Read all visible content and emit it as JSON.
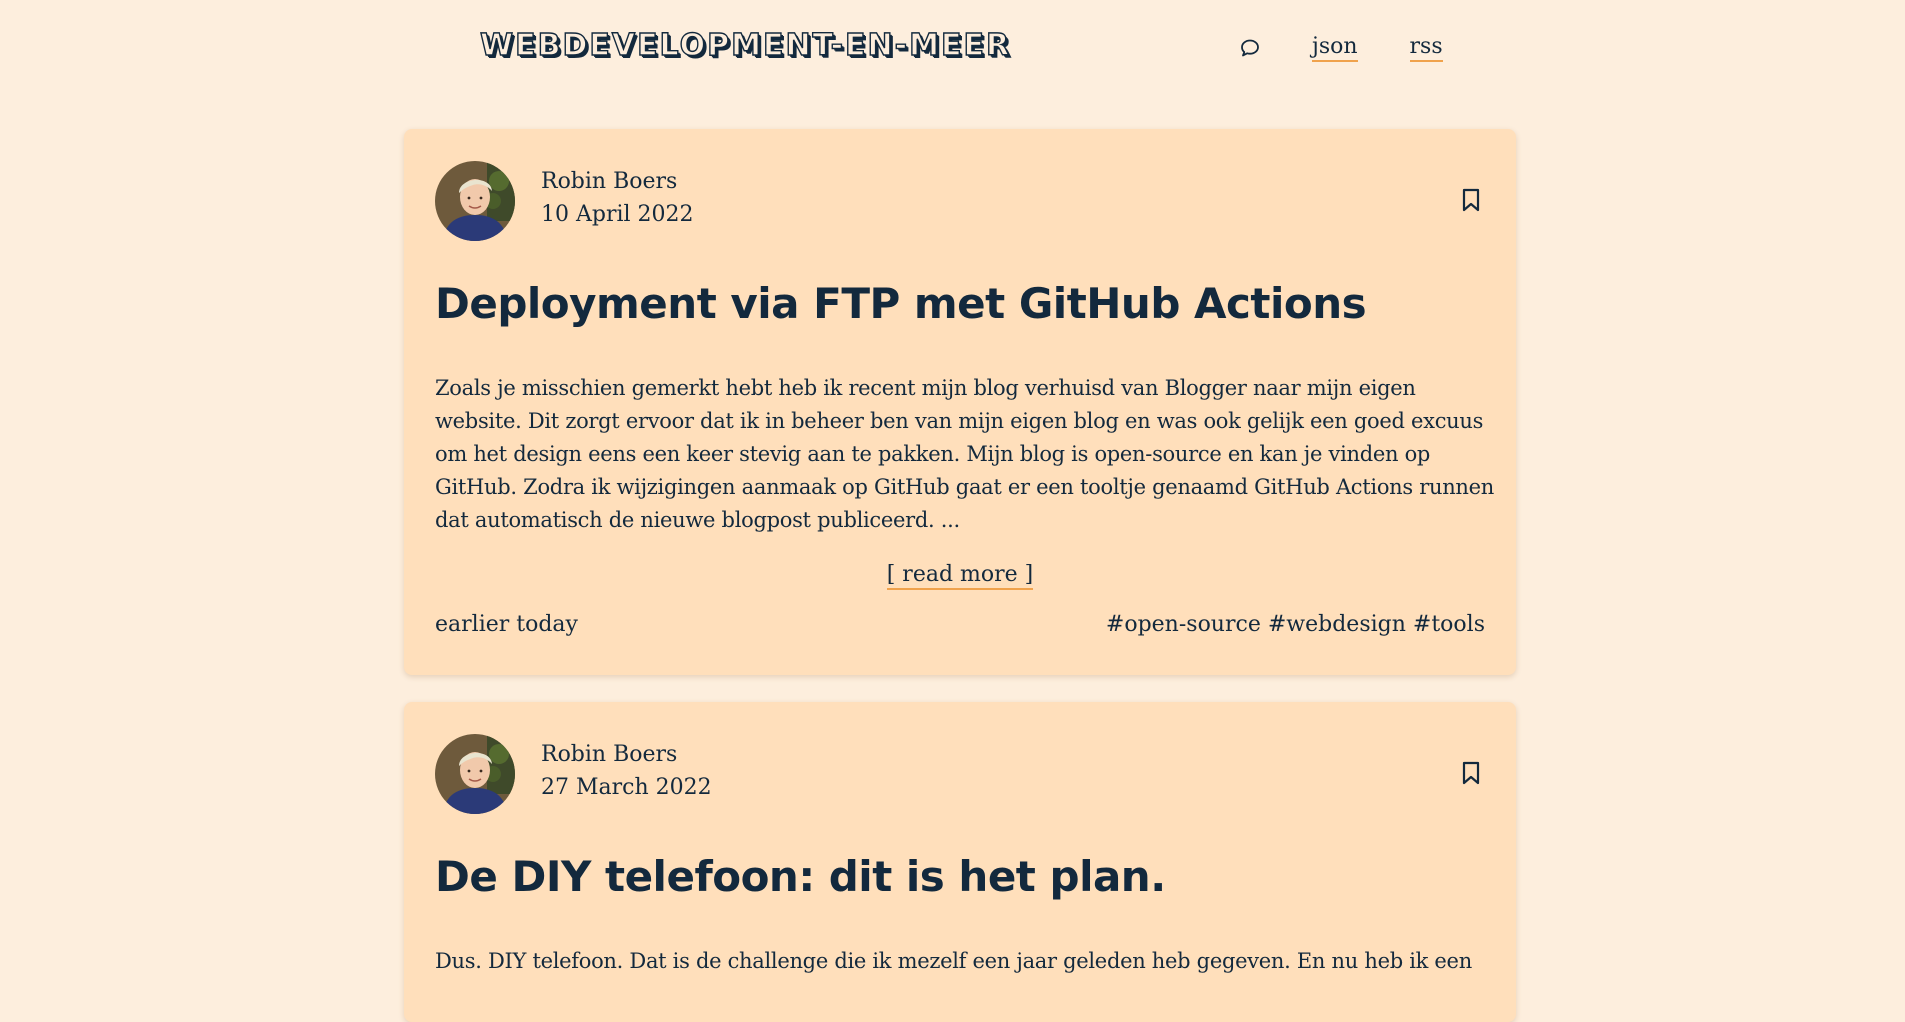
{
  "header": {
    "logo": "webdevelopment-en-meer",
    "nav": {
      "search_icon": "search-icon",
      "json_label": "json",
      "rss_label": "rss"
    }
  },
  "colors": {
    "background": "#fdeedd",
    "card": "#ffdfbb",
    "text": "#13293d",
    "link_underline": "#f0a24c"
  },
  "posts": [
    {
      "author": "Robin Boers",
      "date": "10 April 2022",
      "title": "Deployment via FTP met GitHub Actions",
      "excerpt": "Zoals je misschien gemerkt hebt heb ik recent mijn blog verhuisd van Blogger naar mijn eigen website. Dit zorgt ervoor dat ik in beheer ben van mijn eigen blog en was ook gelijk een goed excuus om het design eens een keer stevig aan te pakken. Mijn blog is open-source en kan je vinden op GitHub. Zodra ik wijzigingen aanmaak op GitHub gaat er een tooltje genaamd GitHub Actions runnen dat automatisch de nieuwe blogpost publiceerd. ...",
      "read_more": "[ read more ]",
      "relative_time": "earlier today",
      "tags": [
        "#open-source",
        "#webdesign",
        "#tools"
      ],
      "bookmark_icon": "bookmark-icon"
    },
    {
      "author": "Robin Boers",
      "date": "27 March 2022",
      "title": "De DIY telefoon: dit is het plan.",
      "excerpt": "Dus. DIY telefoon. Dat is de challenge die ik mezelf een jaar geleden heb gegeven. En nu heb ik een",
      "bookmark_icon": "bookmark-icon"
    }
  ]
}
